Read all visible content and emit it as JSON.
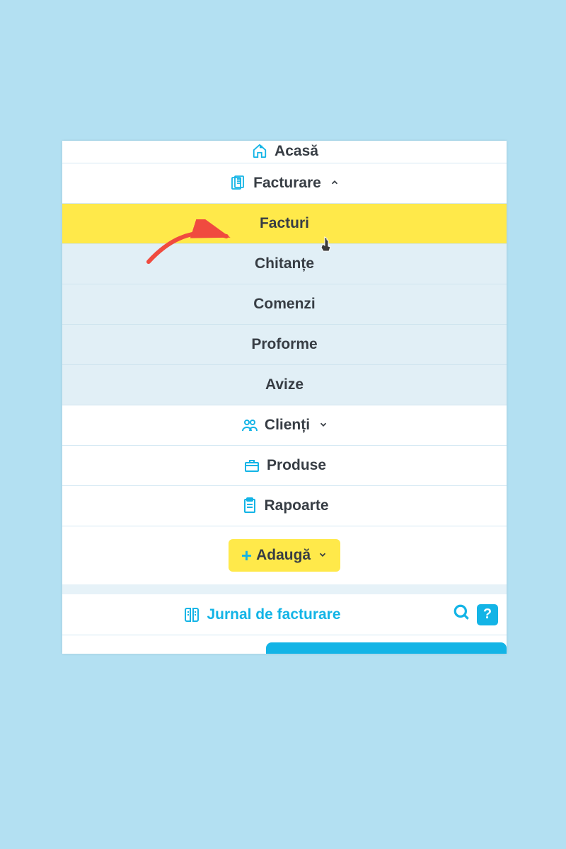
{
  "nav": {
    "home": "Acasă",
    "invoicing": "Facturare",
    "clients": "Clienți",
    "products": "Produse",
    "reports": "Rapoarte"
  },
  "submenu": {
    "invoices": "Facturi",
    "receipts": "Chitanțe",
    "orders": "Comenzi",
    "proformas": "Proforme",
    "notices": "Avize"
  },
  "add_button": "Adaugă",
  "footer": {
    "journal": "Jurnal de facturare",
    "help": "?"
  },
  "colors": {
    "accent": "#13b4e6",
    "highlight": "#ffe94a",
    "bg": "#b3e0f2"
  }
}
